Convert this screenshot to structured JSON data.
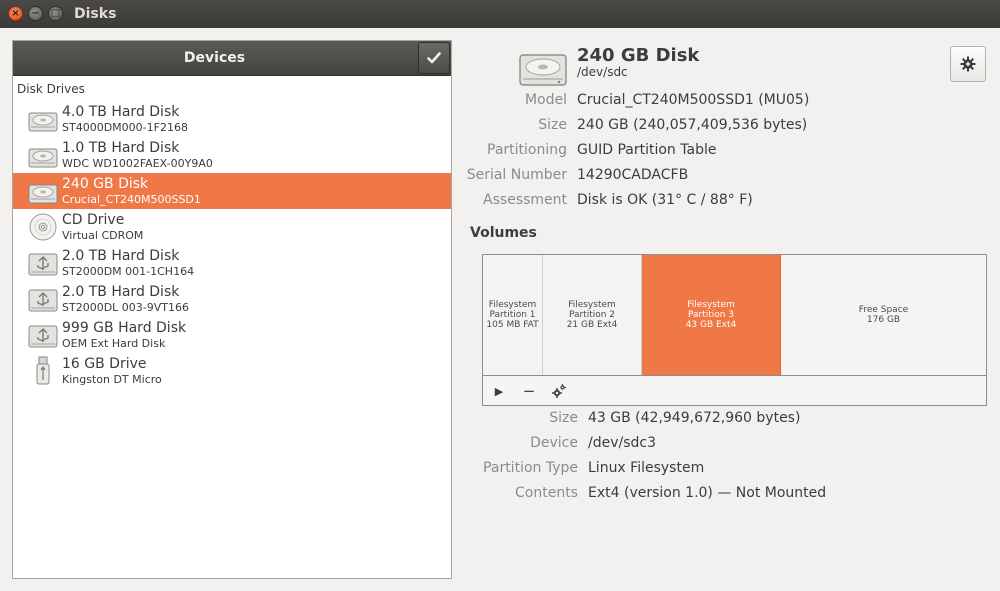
{
  "window": {
    "title": "Disks",
    "close_glyph": "×",
    "min_glyph": "−",
    "max_glyph": "□"
  },
  "devices_panel": {
    "title": "Devices",
    "section_label": "Disk Drives",
    "items": [
      {
        "name": "4.0 TB Hard Disk",
        "sub": "ST4000DM000-1F2168",
        "icon": "hard-disk-icon",
        "selected": false
      },
      {
        "name": "1.0 TB Hard Disk",
        "sub": "WDC WD1002FAEX-00Y9A0",
        "icon": "hard-disk-icon",
        "selected": false
      },
      {
        "name": "240 GB Disk",
        "sub": "Crucial_CT240M500SSD1",
        "icon": "hard-disk-icon",
        "selected": true
      },
      {
        "name": "CD Drive",
        "sub": "Virtual CDROM",
        "icon": "cd-drive-icon",
        "selected": false
      },
      {
        "name": "2.0 TB Hard Disk",
        "sub": "ST2000DM 001-1CH164",
        "icon": "usb-hard-disk-icon",
        "selected": false
      },
      {
        "name": "2.0 TB Hard Disk",
        "sub": "ST2000DL 003-9VT166",
        "icon": "usb-hard-disk-icon",
        "selected": false
      },
      {
        "name": "999 GB Hard Disk",
        "sub": "OEM Ext Hard Disk",
        "icon": "usb-hard-disk-icon",
        "selected": false
      },
      {
        "name": "16 GB Drive",
        "sub": "Kingston DT Micro",
        "icon": "usb-drive-icon",
        "selected": false
      }
    ]
  },
  "disk": {
    "title": "240 GB Disk",
    "device": "/dev/sdc",
    "properties": [
      {
        "key": "Model",
        "value": "Crucial_CT240M500SSD1 (MU05)"
      },
      {
        "key": "Size",
        "value": "240 GB (240,057,409,536 bytes)"
      },
      {
        "key": "Partitioning",
        "value": "GUID Partition Table"
      },
      {
        "key": "Serial Number",
        "value": "14290CADACFB"
      },
      {
        "key": "Assessment",
        "value": "Disk is OK (31° C / 88° F)"
      }
    ]
  },
  "volumes": {
    "label": "Volumes",
    "partitions": [
      {
        "line1": "Filesystem",
        "line2": "Partition 1",
        "line3": "105 MB FAT",
        "selected": false
      },
      {
        "line1": "Filesystem",
        "line2": "Partition 2",
        "line3": "21 GB Ext4",
        "selected": false
      },
      {
        "line1": "Filesystem",
        "line2": "Partition 3",
        "line3": "43 GB Ext4",
        "selected": true
      },
      {
        "line1": "Free Space",
        "line2": "176 GB",
        "line3": "",
        "selected": false
      }
    ],
    "toolbar": {
      "mount_glyph": "▶",
      "delete_glyph": "−"
    },
    "selected_properties": [
      {
        "key": "Size",
        "value": "43 GB (42,949,672,960 bytes)"
      },
      {
        "key": "Device",
        "value": "/dev/sdc3"
      },
      {
        "key": "Partition Type",
        "value": "Linux Filesystem"
      },
      {
        "key": "Contents",
        "value": "Ext4 (version 1.0) — Not Mounted"
      }
    ]
  },
  "colors": {
    "accent": "#f07746",
    "titlebar": "#3c3b37",
    "label_gray": "#8c8b88"
  }
}
